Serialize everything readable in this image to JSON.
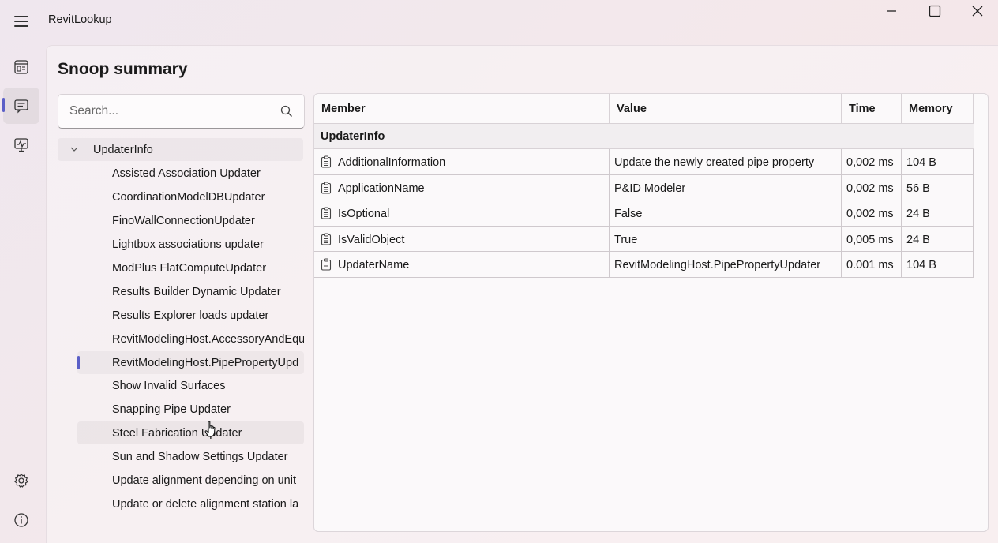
{
  "app": {
    "title": "RevitLookup"
  },
  "page": {
    "title": "Snoop summary"
  },
  "search": {
    "placeholder": "Search..."
  },
  "tree": {
    "root": "UpdaterInfo",
    "items": [
      "Assisted Association Updater",
      "CoordinationModelDBUpdater",
      "FinoWallConnectionUpdater",
      "Lightbox associations updater",
      "ModPlus FlatComputeUpdater",
      "Results Builder Dynamic Updater",
      "Results Explorer loads updater",
      "RevitModelingHost.AccessoryAndEqu",
      "RevitModelingHost.PipePropertyUpd",
      "Show Invalid Surfaces",
      "Snapping Pipe Updater",
      "Steel Fabrication Updater",
      "Sun and Shadow Settings Updater",
      "Update alignment depending on unit",
      "Update or delete alignment station la"
    ],
    "selected_index": 8
  },
  "grid": {
    "columns": [
      "Member",
      "Value",
      "Time",
      "Memory"
    ],
    "group": "UpdaterInfo",
    "rows": [
      {
        "member": "AdditionalInformation",
        "value": "Update the newly created pipe property",
        "time": "0,002 ms",
        "memory": "104 B"
      },
      {
        "member": "ApplicationName",
        "value": "P&ID Modeler",
        "time": "0,002 ms",
        "memory": "56 B"
      },
      {
        "member": "IsOptional",
        "value": "False",
        "time": "0,002 ms",
        "memory": "24 B"
      },
      {
        "member": "IsValidObject",
        "value": "True",
        "time": "0,005 ms",
        "memory": "24 B"
      },
      {
        "member": "UpdaterName",
        "value": "RevitModelingHost.PipePropertyUpdater",
        "time": "0.001 ms",
        "memory": "104 B"
      }
    ]
  },
  "icons": {
    "menu": "hamburger-icon",
    "rail": [
      "dashboard-icon",
      "snoop-summary-icon",
      "events-monitor-icon",
      "settings-icon",
      "info-icon"
    ],
    "member": "clipboard-icon"
  },
  "colors": {
    "accent": "#5b5fc7"
  }
}
